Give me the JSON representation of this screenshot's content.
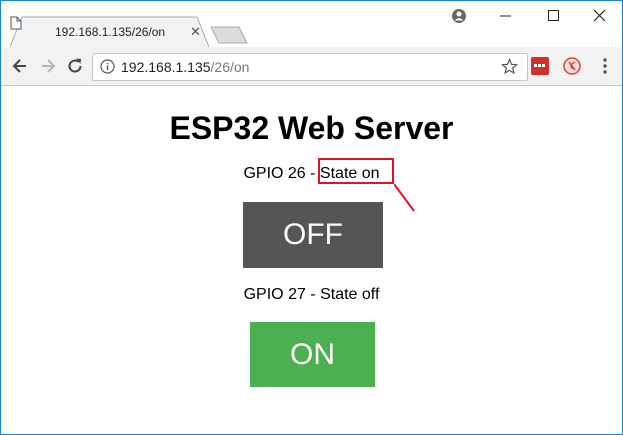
{
  "browser": {
    "tab_title": "192.168.1.135/26/on",
    "url_host": "192.168.1.135",
    "url_path": "/26/on"
  },
  "page": {
    "title": "ESP32 Web Server",
    "gpio26": {
      "label": "GPIO 26 - ",
      "state": "State on",
      "button": "OFF",
      "button_color": "#555555"
    },
    "gpio27": {
      "label": "GPIO 27 - ",
      "state": "State off",
      "button": "ON",
      "button_color": "#4caf50"
    },
    "highlight_color": "#e3102a"
  },
  "icons": [
    "page-favicon-icon",
    "tab-close-icon",
    "account-icon",
    "minimize-icon",
    "maximize-icon",
    "close-window-icon",
    "back-icon",
    "forward-icon",
    "reload-icon",
    "info-icon",
    "star-icon",
    "extension-icon",
    "extension-blocked-icon",
    "menu-icon"
  ]
}
